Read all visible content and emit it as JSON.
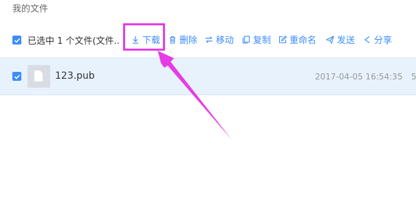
{
  "breadcrumb": "我的文件",
  "toolbar": {
    "selected_text": "已选中 1 个文件(文件..",
    "download": "下载",
    "delete": "删除",
    "move": "移动",
    "copy": "复制",
    "rename": "重命名",
    "send": "发送",
    "share": "分享"
  },
  "files": [
    {
      "name": "123.pub",
      "date": "2017-04-05 16:54:35",
      "size": "5"
    }
  ],
  "colors": {
    "accent": "#3b8cff",
    "annotation": "#e63ce6",
    "row_selected": "#e7f2fd"
  }
}
